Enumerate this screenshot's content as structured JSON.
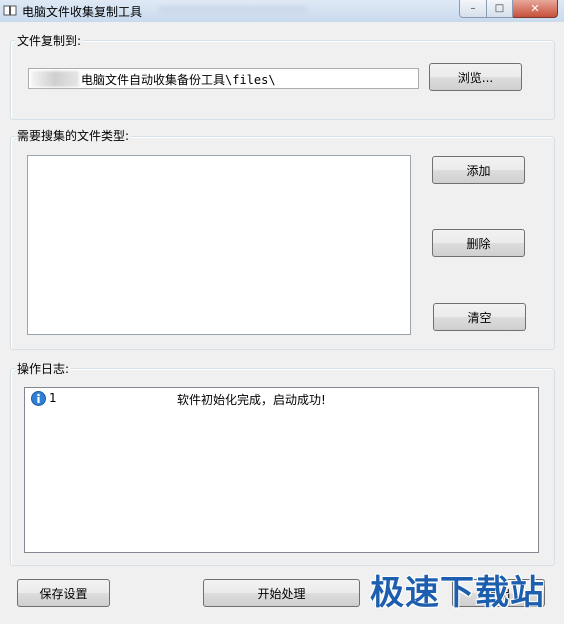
{
  "window": {
    "title": "电脑文件收集复制工具",
    "controls": {
      "minimize": "–",
      "maximize": "□",
      "close": "✕"
    }
  },
  "copy_to": {
    "label": "文件复制到:",
    "path_value": "电脑文件自动收集备份工具\\files\\",
    "browse_label": "浏览..."
  },
  "file_types": {
    "label": "需要搜集的文件类型:",
    "items": [],
    "add_label": "添加",
    "delete_label": "删除",
    "clear_label": "清空"
  },
  "log": {
    "label": "操作日志:",
    "entries": [
      {
        "icon": "info-icon",
        "index": "1",
        "message": "软件初始化完成，启动成功!"
      }
    ]
  },
  "footer": {
    "save_label": "保存设置",
    "start_label": "开始处理",
    "exit_label": "退出"
  },
  "watermark": {
    "text": "极速下载站"
  },
  "colors": {
    "info_icon": "#2f7fd6",
    "watermark": "#1d5fae"
  }
}
